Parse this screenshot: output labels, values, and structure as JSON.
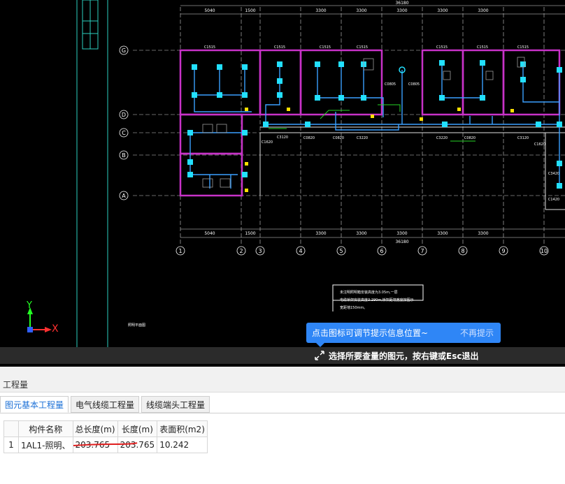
{
  "drawing": {
    "grid_rows": [
      "G",
      "D",
      "C",
      "B",
      "A"
    ],
    "grid_cols": [
      "1",
      "2",
      "3",
      "4",
      "5",
      "6",
      "7",
      "8",
      "9",
      "10"
    ],
    "dims_top": [
      "5040",
      "1500",
      "3300",
      "3300",
      "3300",
      "3300",
      "3300"
    ],
    "dims_bottom": [
      "5040",
      "1500",
      "3300",
      "3300",
      "3300",
      "3300",
      "3300"
    ],
    "dim_total": "36180",
    "window_tags": [
      "C1515",
      "C1515",
      "C1515",
      "C0805",
      "C0805",
      "C1515",
      "C1515",
      "C1515",
      "C1515"
    ],
    "door_tags": [
      "C1620",
      "C3120",
      "C0820",
      "C0820",
      "C3220",
      "C3220",
      "C0820",
      "C3120",
      "C1620",
      "C1420",
      "C3420"
    ],
    "note_lines": [
      "未注明照明箱安装高度为3.05m,一层",
      "电缆桥架安装高度3.290m,桥架距墙宽度按图示",
      "宽距墙150mm。"
    ],
    "drawing_caption": "照明平面图",
    "axis_x": "X",
    "axis_y": "Y",
    "colors": {
      "wall": "#c832c8",
      "wire": "#3aa0ff",
      "fixture": "#22e0ff",
      "grid": "#ffffff",
      "accent": "#2f86f6"
    }
  },
  "tooltip": {
    "text": "点击图标可调节提示信息位置~",
    "dismiss": "不再提示"
  },
  "status": {
    "prompt": "选择所要查量的图元，按右键或Esc退出",
    "prompt_icon": "pick-cursor-icon"
  },
  "panel": {
    "title": "工程量",
    "tabs": [
      {
        "label": "图元基本工程量",
        "active": true
      },
      {
        "label": "电气线缆工程量",
        "active": false
      },
      {
        "label": "线缆端头工程量",
        "active": false
      }
    ],
    "table": {
      "headers": [
        "",
        "构件名称",
        "总长度(m)",
        "长度(m)",
        "表面积(m2)"
      ],
      "rows": [
        [
          "1",
          "1AL1-照明、",
          "203.765",
          "203.765",
          "10.242"
        ]
      ]
    }
  }
}
